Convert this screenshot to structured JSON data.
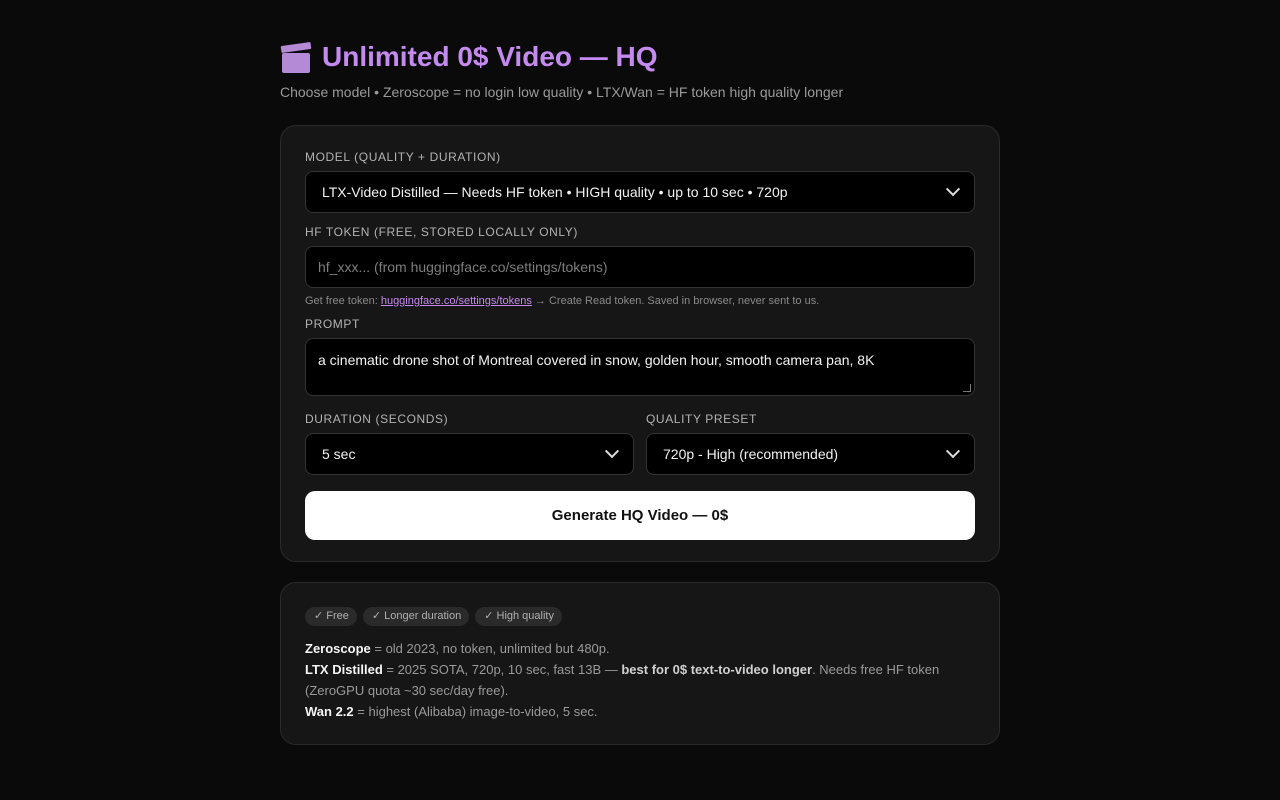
{
  "header": {
    "title": "Unlimited 0$ Video — HQ",
    "subtitle": "Choose model • Zeroscope = no login low quality • LTX/Wan = HF token high quality longer"
  },
  "form": {
    "model_label": "MODEL (QUALITY + DURATION)",
    "model_value": "LTX-Video Distilled — Needs HF token • HIGH quality • up to 10 sec • 720p",
    "token_label": "HF TOKEN (FREE, STORED LOCALLY ONLY)",
    "token_placeholder": "hf_xxx... (from huggingface.co/settings/tokens)",
    "token_hint_prefix": "Get free token: ",
    "token_hint_link": "huggingface.co/settings/tokens",
    "token_hint_suffix": " → Create Read token. Saved in browser, never sent to us.",
    "prompt_label": "PROMPT",
    "prompt_value": "a cinematic drone shot of Montreal covered in snow, golden hour, smooth camera pan, 8K",
    "duration_label": "DURATION (SECONDS)",
    "duration_value": "5 sec",
    "quality_label": "QUALITY PRESET",
    "quality_value": "720p - High (recommended)",
    "generate_label": "Generate HQ Video — 0$"
  },
  "info": {
    "tags": [
      "✓ Free",
      "✓ Longer duration",
      "✓ High quality"
    ],
    "zeroscope_name": "Zeroscope",
    "zeroscope_text": " = old 2023, no token, unlimited but 480p.",
    "ltx_name": "LTX Distilled",
    "ltx_text_1": " = 2025 SOTA, 720p, 10 sec, fast 13B — ",
    "ltx_strong": "best for 0$ text-to-video longer",
    "ltx_text_2": ". Needs free HF token (ZeroGPU quota ~30 sec/day free).",
    "wan_name": "Wan 2.2",
    "wan_text": " = highest (Alibaba) image-to-video, 5 sec."
  },
  "colors": {
    "accent": "#c58af0",
    "background": "#0a0a0a",
    "card": "#161616"
  },
  "icons": {
    "title_icon": "clapper-board-icon"
  }
}
